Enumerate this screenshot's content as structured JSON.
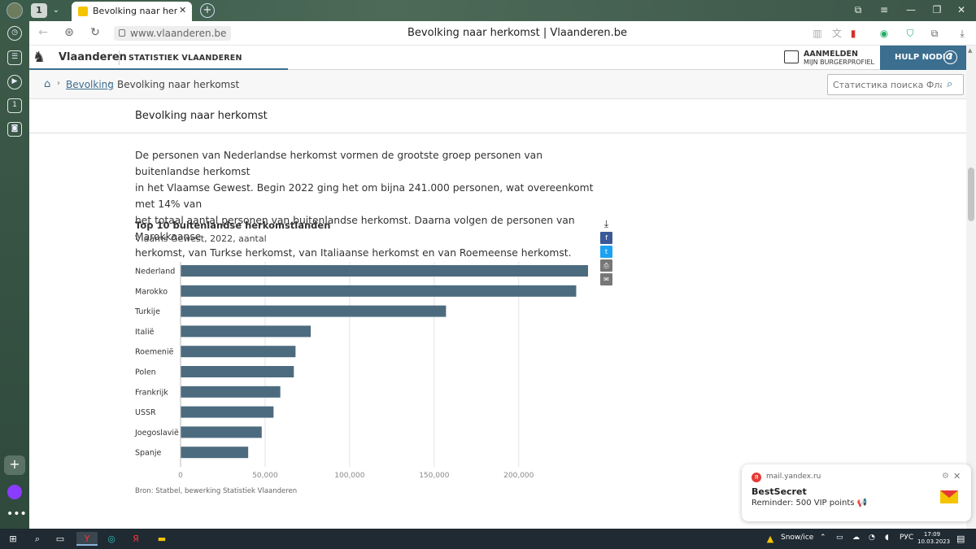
{
  "browser": {
    "tab_count": "1",
    "tab_title": "Bevolking naar herkomst | Vlaanderen.be",
    "url": "www.vlaanderen.be",
    "page_title": "Bevolking naar herkomst | Vlaanderen.be"
  },
  "site": {
    "brand": "Vlaanderen",
    "subbrand": "STATISTIEK VLAANDEREN",
    "login_line1": "AANMELDEN",
    "login_line2": "MIJN BURGERPROFIEL",
    "help_label": "HULP NODIG",
    "help_icon": "?"
  },
  "breadcrumb": {
    "items": [
      "Bevolking",
      "Bevolking naar herkomst"
    ]
  },
  "search": {
    "placeholder": "Статистика поиска Фла..."
  },
  "page": {
    "heading": "Bevolking naar herkomst",
    "intro_lines": [
      "De personen van Nederlandse herkomst vormen de grootste groep personen van buitenlandse herkomst",
      "in het Vlaamse Gewest. Begin 2022 ging het om bijna 241.000 personen, wat overeenkomt met 14% van",
      "het totaal aantal personen van buitenlandse herkomst. Daarna volgen de personen van Marokkaanse",
      "herkomst, van Turkse herkomst, van Italiaanse herkomst en van Roemeense herkomst."
    ],
    "source": "Bron: Statbel, bewerking Statistiek Vlaanderen"
  },
  "share": {
    "icons": [
      "download-icon",
      "facebook-icon",
      "twitter-icon",
      "print-icon",
      "mail-icon"
    ],
    "labels": [
      "⤓",
      "f",
      "t",
      "⎙",
      "✉"
    ],
    "colors": [
      "#ffffff",
      "#3b5998",
      "#1da1f2",
      "#777777",
      "#777777"
    ]
  },
  "chart_data": {
    "type": "bar",
    "orientation": "horizontal",
    "title": "Top 10 buitenlandse herkomstlanden",
    "subtitle": "Vlaams Gewest, 2022, aantal",
    "categories": [
      "Nederland",
      "Marokko",
      "Turkije",
      "Italië",
      "Roemenië",
      "Polen",
      "Frankrijk",
      "USSR",
      "Joegoslavië",
      "Spanje"
    ],
    "values": [
      241000,
      234000,
      157000,
      77000,
      68000,
      67000,
      59000,
      55000,
      48000,
      40000
    ],
    "xlim": [
      0,
      241000
    ],
    "xticks": [
      0,
      50000,
      100000,
      150000,
      200000
    ],
    "xtick_labels": [
      "0",
      "50,000",
      "100,000",
      "150,000",
      "200,000"
    ],
    "grid": true,
    "bar_color": "#4d6b7f",
    "legend": "none"
  },
  "notification": {
    "source": "mail.yandex.ru",
    "title": "BestSecret",
    "body": "Reminder: 500 VIP points 📢"
  },
  "taskbar": {
    "weather": "Snow/ice",
    "language": "РУС",
    "time": "17:09",
    "date": "10.03.2023"
  },
  "colors": {
    "accent": "#3b6e8f",
    "bar": "#4d6b7f"
  }
}
